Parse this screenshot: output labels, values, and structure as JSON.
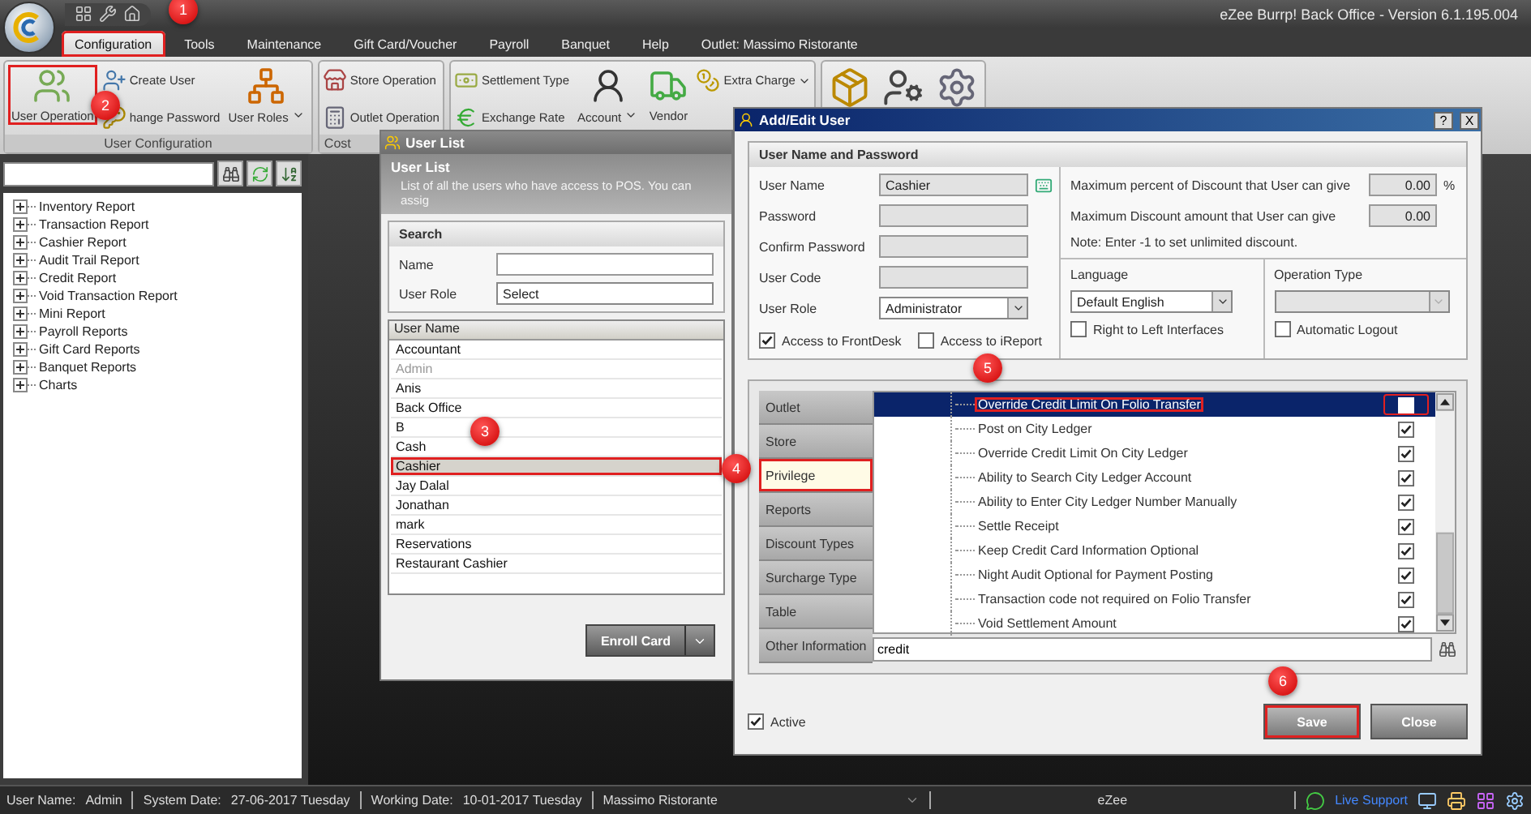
{
  "window": {
    "title": "eZee Burrp! Back Office - Version 6.1.195.004"
  },
  "menu_tabs": [
    {
      "label": "Configuration",
      "selected": true,
      "highlighted": true
    },
    {
      "label": "Tools",
      "selected": false,
      "highlighted": false
    },
    {
      "label": "Maintenance",
      "selected": false,
      "highlighted": false
    },
    {
      "label": "Gift Card/Voucher",
      "selected": false,
      "highlighted": false
    },
    {
      "label": "Payroll",
      "selected": false,
      "highlighted": false
    },
    {
      "label": "Banquet",
      "selected": false,
      "highlighted": false
    },
    {
      "label": "Help",
      "selected": false,
      "highlighted": false
    },
    {
      "label": "Outlet: Massimo Ristorante",
      "selected": false,
      "highlighted": false
    }
  ],
  "ribbon": {
    "groups": [
      {
        "label": "User Configuration",
        "items": [
          {
            "kind": "large",
            "label": "User Operation",
            "menu": false,
            "highlighted": true
          },
          {
            "kind": "stack",
            "items": [
              {
                "label": "Create User",
                "menu": false
              },
              {
                "label": "hange Password",
                "menu": false
              }
            ]
          },
          {
            "kind": "large",
            "label": "User Roles",
            "menu": true,
            "highlighted": false
          }
        ]
      },
      {
        "label": "Cost",
        "items": [
          {
            "kind": "stack",
            "items": [
              {
                "label": "Store Operation",
                "menu": false
              },
              {
                "label": "Outlet Operation",
                "menu": false
              }
            ]
          }
        ]
      },
      {
        "items": [
          {
            "kind": "stack",
            "items": [
              {
                "label": "Settlement Type",
                "menu": false
              },
              {
                "label": "Exchange Rate",
                "menu": false
              }
            ]
          },
          {
            "kind": "large",
            "label": "Account",
            "menu": true,
            "highlighted": false
          },
          {
            "kind": "large",
            "label": "Vendor",
            "menu": false,
            "highlighted": false
          },
          {
            "kind": "stack",
            "items": [
              {
                "label": "Extra Charge",
                "menu": true
              }
            ]
          }
        ]
      },
      {
        "items": [
          {
            "kind": "icon",
            "highlighted": false
          },
          {
            "kind": "icon",
            "highlighted": false
          },
          {
            "kind": "icon",
            "highlighted": false
          }
        ]
      }
    ]
  },
  "report_tree": [
    {
      "label": "Inventory Report",
      "expanded": false
    },
    {
      "label": "Transaction Report",
      "expanded": false
    },
    {
      "label": "Cashier Report",
      "expanded": false
    },
    {
      "label": "Audit Trail Report",
      "expanded": false
    },
    {
      "label": "Credit Report",
      "expanded": false
    },
    {
      "label": "Void Transaction Report",
      "expanded": false
    },
    {
      "label": "Mini Report",
      "expanded": false
    },
    {
      "label": "Payroll Reports",
      "expanded": false
    },
    {
      "label": "Gift Card Reports",
      "expanded": false
    },
    {
      "label": "Banquet Reports",
      "expanded": false
    },
    {
      "label": "Charts",
      "expanded": false
    }
  ],
  "user_list": {
    "title": "User List",
    "heading": "User List",
    "description": "List of all the users who have access to POS. You can assig",
    "search": {
      "title": "Search",
      "name_label": "Name",
      "role_label": "User Role",
      "role_value": "Select"
    },
    "column": "User Name",
    "rows": [
      {
        "name": "Accountant",
        "selected": false,
        "disabled": false,
        "highlighted": false
      },
      {
        "name": "Admin",
        "selected": false,
        "disabled": true,
        "highlighted": false
      },
      {
        "name": "Anis",
        "selected": false,
        "disabled": false,
        "highlighted": false
      },
      {
        "name": "Back Office",
        "selected": false,
        "disabled": false,
        "highlighted": false
      },
      {
        "name": "B",
        "selected": false,
        "disabled": false,
        "highlighted": false
      },
      {
        "name": "Cash",
        "selected": false,
        "disabled": false,
        "highlighted": false
      },
      {
        "name": "Cashier",
        "selected": true,
        "disabled": false,
        "highlighted": true
      },
      {
        "name": "Jay Dalal",
        "selected": false,
        "disabled": false,
        "highlighted": false
      },
      {
        "name": "Jonathan",
        "selected": false,
        "disabled": false,
        "highlighted": false
      },
      {
        "name": "mark",
        "selected": false,
        "disabled": false,
        "highlighted": false
      },
      {
        "name": "Reservations",
        "selected": false,
        "disabled": false,
        "highlighted": false
      },
      {
        "name": "Restaurant Cashier",
        "selected": false,
        "disabled": false,
        "highlighted": false
      }
    ],
    "button": "Enroll Card"
  },
  "dialog": {
    "title": "Add/Edit User",
    "help_button": "?",
    "close_button": "X",
    "section": "User Name and Password",
    "fields": [
      {
        "label": "User Name",
        "value": "Cashier",
        "kind": "text"
      },
      {
        "label": "Password",
        "kind": "text"
      },
      {
        "label": "Confirm Password",
        "kind": "text"
      },
      {
        "label": "User Code",
        "kind": "text"
      },
      {
        "label": "User Role",
        "value": "Administrator",
        "kind": "select"
      }
    ],
    "access": [
      {
        "label": "Access to FrontDesk",
        "checked": true
      },
      {
        "label": "Access to iReport",
        "checked": false
      }
    ],
    "discount": [
      {
        "label": "Maximum percent of Discount that User can give",
        "value": "0.00",
        "unit": "%"
      },
      {
        "label": "Maximum Discount amount that User can give",
        "value": "0.00"
      }
    ],
    "note": "Note: Enter -1 to set unlimited discount.",
    "language": {
      "label": "Language",
      "value": "Default English",
      "option": {
        "label": "Right to Left Interfaces",
        "checked": false
      }
    },
    "operation_type": {
      "label": "Operation Type",
      "disabled": true,
      "option": {
        "label": "Automatic Logout",
        "checked": false
      }
    },
    "side_tabs": [
      {
        "label": "Outlet",
        "selected": false,
        "highlighted": false
      },
      {
        "label": "Store",
        "selected": false,
        "highlighted": false
      },
      {
        "label": "Privilege",
        "selected": true,
        "highlighted": true
      },
      {
        "label": "Reports",
        "selected": false,
        "highlighted": false
      },
      {
        "label": "Discount Types",
        "selected": false,
        "highlighted": false
      },
      {
        "label": "Surcharge Type",
        "selected": false,
        "highlighted": false
      },
      {
        "label": "Table",
        "selected": false,
        "highlighted": false
      },
      {
        "label": "Other Information",
        "selected": false,
        "highlighted": false
      }
    ],
    "privileges": [
      {
        "label": "Override Credit Limit On Folio Transfer",
        "checked": false,
        "selected": true,
        "highlighted": true,
        "check_highlighted": true
      },
      {
        "label": "Post on City Ledger",
        "checked": true,
        "selected": false,
        "highlighted": false,
        "check_highlighted": false
      },
      {
        "label": "Override Credit Limit On City Ledger",
        "checked": true,
        "selected": false,
        "highlighted": false,
        "check_highlighted": false
      },
      {
        "label": "Ability to Search City Ledger Account",
        "checked": true,
        "selected": false,
        "highlighted": false,
        "check_highlighted": false
      },
      {
        "label": "Ability to Enter City Ledger Number Manually",
        "checked": true,
        "selected": false,
        "highlighted": false,
        "check_highlighted": false
      },
      {
        "label": "Settle Receipt",
        "checked": true,
        "selected": false,
        "highlighted": false,
        "check_highlighted": false
      },
      {
        "label": "Keep Credit Card Information Optional",
        "checked": true,
        "selected": false,
        "highlighted": false,
        "check_highlighted": false
      },
      {
        "label": "Night Audit Optional for Payment Posting",
        "checked": true,
        "selected": false,
        "highlighted": false,
        "check_highlighted": false
      },
      {
        "label": "Transaction code not required on Folio Transfer",
        "checked": true,
        "selected": false,
        "highlighted": false,
        "check_highlighted": false
      },
      {
        "label": "Void Settlement Amount",
        "checked": true,
        "selected": false,
        "highlighted": false,
        "check_highlighted": false
      }
    ],
    "filter": "credit",
    "active": {
      "label": "Active",
      "checked": true
    },
    "buttons": [
      {
        "label": "Save",
        "highlighted": true
      },
      {
        "label": "Close",
        "highlighted": false
      }
    ]
  },
  "annotations": [
    {
      "label": "1"
    },
    {
      "label": "2"
    },
    {
      "label": "3"
    },
    {
      "label": "4"
    },
    {
      "label": "5"
    },
    {
      "label": "6"
    }
  ],
  "status_bar": {
    "items": [
      {
        "label": "User Name:",
        "value": "Admin"
      },
      {
        "label": "System Date:",
        "value": "27-06-2017 Tuesday"
      },
      {
        "label": "Working Date:",
        "value": "10-01-2017 Tuesday"
      }
    ],
    "outlet": "Massimo Ristorante",
    "center": "eZee",
    "support": "Live Support"
  }
}
